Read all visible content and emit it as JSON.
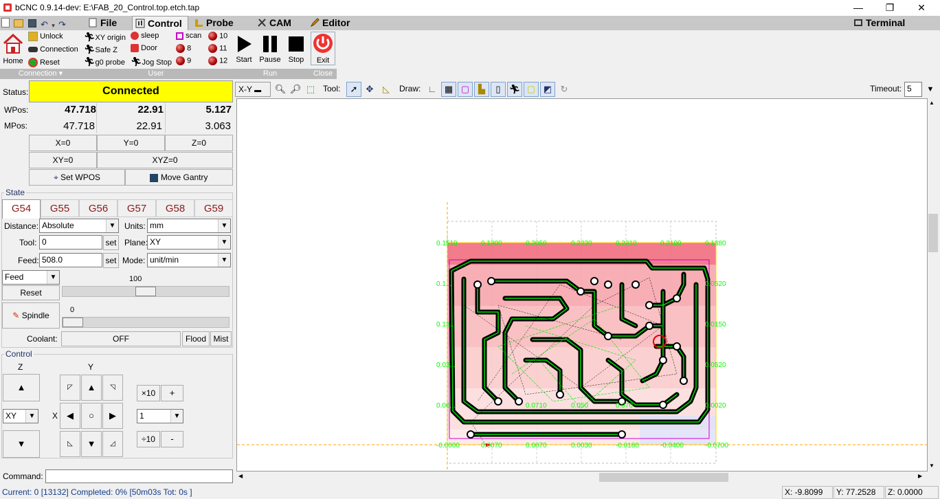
{
  "window": {
    "title": "bCNC 0.9.14-dev: E:\\FAB_20_Control.top.etch.tap",
    "minimize": "—",
    "restore": "❐",
    "close": "✕"
  },
  "tabs": [
    "File",
    "Control",
    "Probe",
    "CAM",
    "Editor"
  ],
  "terminal_tab": "Terminal",
  "ribbon": {
    "connection": {
      "home": "Home",
      "unlock": "Unlock",
      "connection": "Connection",
      "reset": "Reset",
      "group": "Connection ▾"
    },
    "user": {
      "xy_origin": "XY origin",
      "safe_z": "Safe Z",
      "g0_probe": "g0 probe",
      "sleep": "sleep",
      "door": "Door",
      "jog_stop": "Jog Stop",
      "scan": "scan",
      "b8": "8",
      "b9": "9",
      "b10": "10",
      "b11": "11",
      "b12": "12",
      "group": "User"
    },
    "run": {
      "start": "Start",
      "pause": "Pause",
      "stop": "Stop",
      "group": "Run"
    },
    "close": {
      "exit": "Exit",
      "group": "Close"
    }
  },
  "status": {
    "label": "Status:",
    "value": "Connected",
    "color": "#ffff00"
  },
  "wpos": {
    "label": "WPos:",
    "x": "47.718",
    "y": "22.91",
    "z": "5.127"
  },
  "mpos": {
    "label": "MPos:",
    "x": "47.718",
    "y": "22.91",
    "z": "3.063"
  },
  "zero_buttons": {
    "x": "X=0",
    "y": "Y=0",
    "z": "Z=0",
    "xy": "XY=0",
    "xyz": "XYZ=0"
  },
  "set_wpos": "Set WPOS",
  "move_gantry": "Move Gantry",
  "state": {
    "frame_label": "State",
    "wcs": [
      "G54",
      "G55",
      "G56",
      "G57",
      "G58",
      "G59"
    ],
    "distance_label": "Distance:",
    "distance": "Absolute",
    "units_label": "Units:",
    "units": "mm",
    "tool_label": "Tool:",
    "tool": "0",
    "set": "set",
    "plane_label": "Plane:",
    "plane": "XY",
    "feed_label": "Feed:",
    "feed": "508.0",
    "mode_label": "Mode:",
    "mode": "unit/min",
    "override": "Feed",
    "override_value": "100",
    "reset": "Reset",
    "spindle": "Spindle",
    "spindle_value": "0",
    "coolant_label": "Coolant:",
    "coolant": "OFF",
    "flood": "Flood",
    "mist": "Mist"
  },
  "control": {
    "frame_label": "Control",
    "z_label": "Z",
    "y_label": "Y",
    "x_label": "X",
    "plane": "XY",
    "x10": "×10",
    "plus": "+",
    "step": "1",
    "div10": "÷10",
    "minus": "-"
  },
  "command_label": "Command:",
  "toolbar": {
    "view": "X-Y",
    "tool_label": "Tool:",
    "draw_label": "Draw:",
    "timeout_label": "Timeout:",
    "timeout": "5"
  },
  "grid_labels": {
    "top": [
      "0.1510",
      "0.1300",
      "0.2050",
      "0.2220",
      "0.2310",
      "0.2100",
      "0.1380"
    ],
    "left": [
      "0.1...",
      "0.13...",
      "0.03...",
      "0.06..."
    ],
    "right": [
      "0.0520",
      "0.0150",
      "0.0520",
      "0.0020"
    ],
    "bottom": [
      "-0.0000",
      "0.0070",
      "0.0070",
      "0.0030",
      "-0.0180",
      "-0.0400",
      "-0.0700"
    ],
    "mid": [
      "0.0710",
      "0.050",
      "0.070"
    ]
  },
  "statusbar": {
    "progress": "Current: 0 [13132]  Completed: 0% [50m03s Tot: 0s ]",
    "x": "X: -9.8099",
    "y": "Y: 77.2528",
    "z": "Z: 0.0000"
  },
  "colors": {
    "accent_green": "#00ff00",
    "connected": "#ffff00",
    "gtab_text": "#8b1a1a"
  }
}
